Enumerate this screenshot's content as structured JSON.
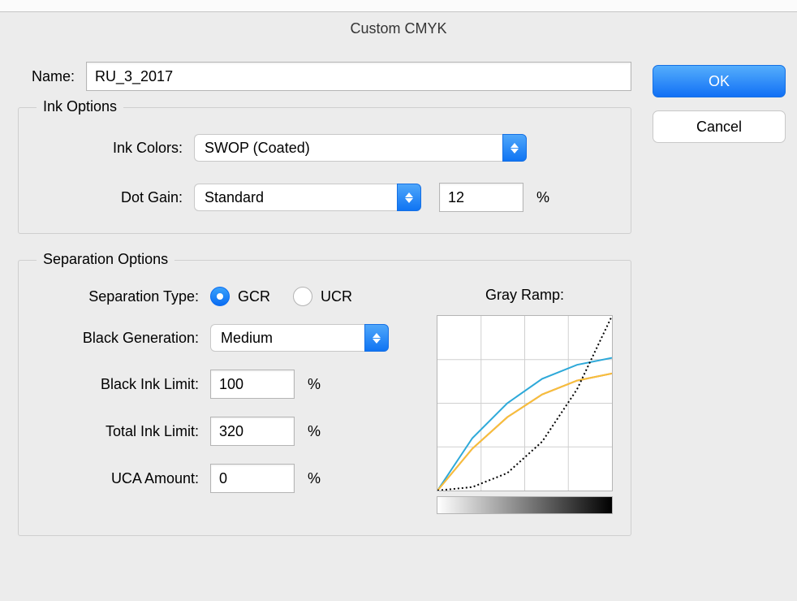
{
  "dialog": {
    "title": "Custom CMYK",
    "name_label": "Name:",
    "name_value": "RU_3_2017",
    "ok": "OK",
    "cancel": "Cancel"
  },
  "ink": {
    "legend": "Ink Options",
    "colors_label": "Ink Colors:",
    "colors_value": "SWOP (Coated)",
    "dotgain_label": "Dot Gain:",
    "dotgain_type": "Standard",
    "dotgain_value": "12",
    "percent": "%"
  },
  "sep": {
    "legend": "Separation Options",
    "type_label": "Separation Type:",
    "type_options": {
      "gcr": "GCR",
      "ucr": "UCR"
    },
    "type_selected": "gcr",
    "blackgen_label": "Black Generation:",
    "blackgen_value": "Medium",
    "blackink_label": "Black Ink Limit:",
    "blackink_value": "100",
    "totalink_label": "Total Ink Limit:",
    "totalink_value": "320",
    "uca_label": "UCA Amount:",
    "uca_value": "0",
    "percent": "%",
    "ramp_label": "Gray Ramp:"
  },
  "chart_data": {
    "type": "line",
    "xlabel": "",
    "ylabel": "",
    "xlim": [
      0,
      100
    ],
    "ylim": [
      0,
      100
    ],
    "series": [
      {
        "name": "cyan",
        "color": "#2ea9d9",
        "x": [
          0,
          20,
          40,
          60,
          80,
          100
        ],
        "y": [
          0,
          30,
          50,
          64,
          72,
          76
        ]
      },
      {
        "name": "magenta",
        "color": "#f04060",
        "x": [
          0,
          20,
          40,
          60,
          80,
          100
        ],
        "y": [
          0,
          24,
          42,
          55,
          63,
          67
        ]
      },
      {
        "name": "yellow",
        "color": "#f5c23a",
        "x": [
          0,
          20,
          40,
          60,
          80,
          100
        ],
        "y": [
          0,
          24,
          42,
          55,
          63,
          67
        ]
      },
      {
        "name": "black",
        "color": "#000000",
        "x": [
          0,
          20,
          40,
          60,
          80,
          100
        ],
        "y": [
          0,
          2,
          10,
          28,
          58,
          100
        ],
        "dotted": true
      }
    ]
  }
}
